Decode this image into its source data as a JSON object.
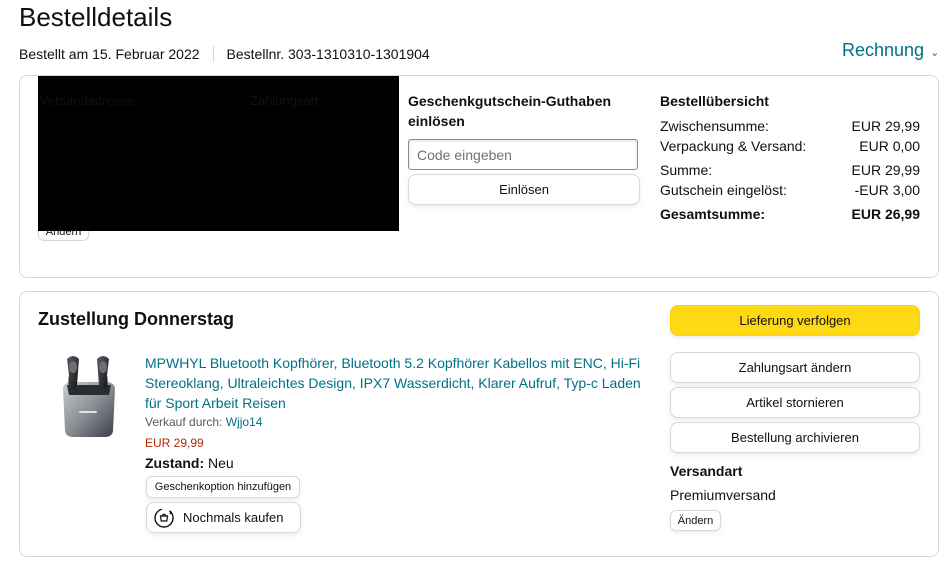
{
  "page": {
    "title": "Bestelldetails",
    "order_date": "Bestellt am 15. Februar 2022",
    "order_number": "Bestellnr. 303-1310310-1301904",
    "invoice_label": "Rechnung"
  },
  "address_block": {
    "shipping_heading": "Versandadresse",
    "payment_heading": "Zahlungsart",
    "change_label": "Ändern"
  },
  "gift_card": {
    "title": "Geschenkgutschein-Guthaben einlösen",
    "input_placeholder": "Code eingeben",
    "redeem_label": "Einlösen"
  },
  "summary": {
    "title": "Bestellübersicht",
    "rows": [
      {
        "label": "Zwischensumme:",
        "value": "EUR 29,99"
      },
      {
        "label": "Verpackung & Versand:",
        "value": "EUR 0,00"
      },
      {
        "label": "Summe:",
        "value": "EUR 29,99"
      },
      {
        "label": "Gutschein eingelöst:",
        "value": "-EUR 3,00"
      },
      {
        "label": "Gesamtsumme:",
        "value": "EUR 26,99"
      }
    ]
  },
  "delivery": {
    "title": "Zustellung Donnerstag",
    "product_title": "MPWHYL Bluetooth Kopfhörer, Bluetooth 5.2 Kopfhörer Kabellos mit ENC, Hi-Fi Stereoklang, Ultraleichtes Design, IPX7 Wasserdicht, Klarer Aufruf, Typ-c Laden für Sport Arbeit Reisen",
    "seller_prefix": "Verkauf durch: ",
    "seller_name": "Wjjo14",
    "price": "EUR 29,99",
    "condition_label": "Zustand:",
    "condition_value": "Neu",
    "gift_option_label": "Geschenkoption hinzufügen",
    "buy_again_label": "Nochmals kaufen"
  },
  "actions": {
    "track_label": "Lieferung verfolgen",
    "change_payment_label": "Zahlungsart ändern",
    "cancel_label": "Artikel stornieren",
    "archive_label": "Bestellung archivieren"
  },
  "shipping": {
    "title": "Versandart",
    "value": "Premiumversand",
    "change_label": "Ändern"
  },
  "colors": {
    "link": "#007185",
    "price": "#b12704",
    "primary_button": "#ffd814",
    "border": "#d5d9d9"
  }
}
